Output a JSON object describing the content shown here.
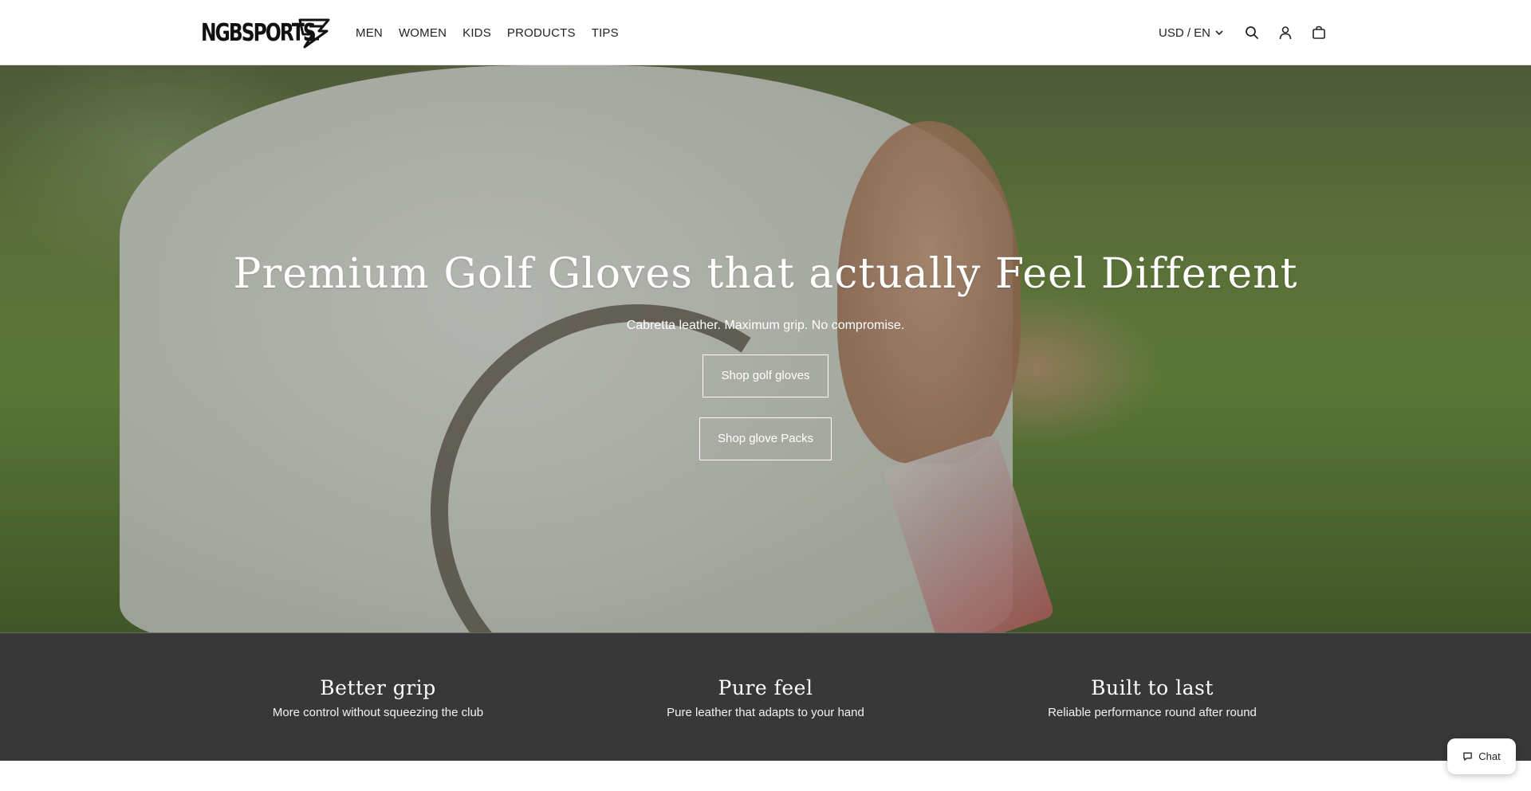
{
  "header": {
    "logo_text": "NGBSPORTS",
    "nav": [
      {
        "label": "MEN"
      },
      {
        "label": "WOMEN"
      },
      {
        "label": "KIDS"
      },
      {
        "label": "PRODUCTS"
      },
      {
        "label": "TIPS"
      }
    ],
    "locale_label": "USD / EN",
    "icons": [
      "search-icon",
      "account-icon",
      "cart-icon"
    ]
  },
  "hero": {
    "title": "Premium Golf Gloves that actually Feel Different",
    "subtitle": "Cabretta leather. Maximum grip. No compromise.",
    "primary_button": "Shop golf gloves",
    "secondary_button": "Shop glove Packs"
  },
  "features": [
    {
      "title": "Better grip",
      "text": "More control without squeezing the club"
    },
    {
      "title": "Pure feel",
      "text": "Pure leather that adapts to your hand"
    },
    {
      "title": "Built to last",
      "text": "Reliable performance round after round"
    }
  ],
  "chat": {
    "label": "Chat"
  },
  "colors": {
    "header_bg": "#ffffff",
    "features_bg": "#383838",
    "text_light": "#ffffff",
    "text_dark": "#222222"
  }
}
